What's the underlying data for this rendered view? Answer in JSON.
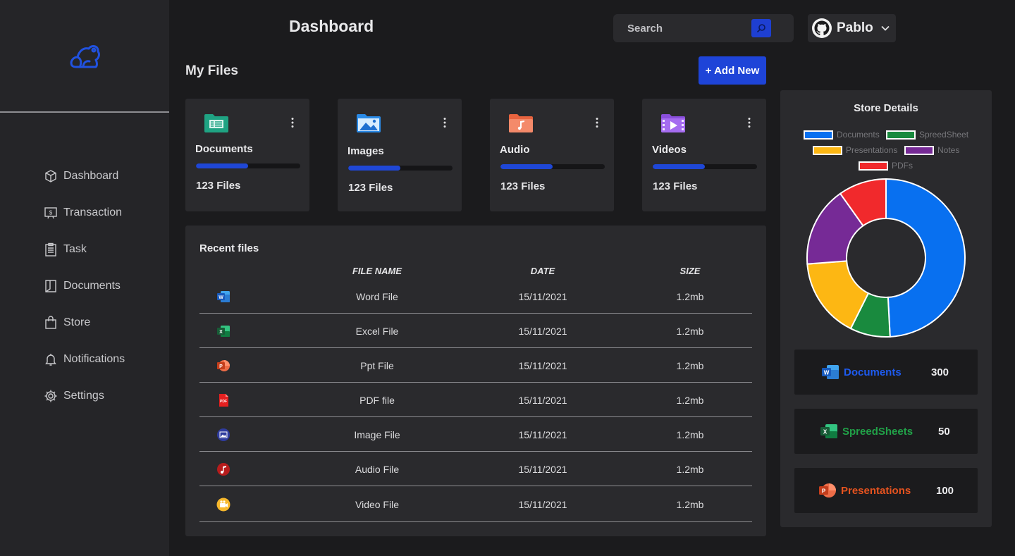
{
  "header": {
    "title": "Dashboard",
    "search_placeholder": "Search",
    "user_name": "Pablo"
  },
  "sidebar": {
    "items": [
      {
        "label": "Dashboard",
        "icon": "cube-icon"
      },
      {
        "label": "Transaction",
        "icon": "dollar-icon"
      },
      {
        "label": "Task",
        "icon": "clipboard-icon"
      },
      {
        "label": "Documents",
        "icon": "book-icon"
      },
      {
        "label": "Store",
        "icon": "bag-icon"
      },
      {
        "label": "Notifications",
        "icon": "bell-icon"
      },
      {
        "label": "Settings",
        "icon": "gear-icon"
      }
    ]
  },
  "my_files": {
    "title": "My Files",
    "add_label": "+ Add New",
    "cards": [
      {
        "name": "Documents",
        "count": "123 Files",
        "progress": 0.5,
        "color": "#1fa383"
      },
      {
        "name": "Images",
        "count": "123 Files",
        "progress": 0.5,
        "color": "#2a8be8"
      },
      {
        "name": "Audio",
        "count": "123 Files",
        "progress": 0.5,
        "color": "#f0795a"
      },
      {
        "name": "Videos",
        "count": "123 Files",
        "progress": 0.5,
        "color": "#9a5ae6"
      }
    ]
  },
  "recent": {
    "title": "Recent files",
    "columns": [
      "FILE NAME",
      "DATE",
      "SIZE"
    ],
    "rows": [
      {
        "icon": "word-icon",
        "name": "Word File",
        "date": "15/11/2021",
        "size": "1.2mb"
      },
      {
        "icon": "excel-icon",
        "name": "Excel File",
        "date": "15/11/2021",
        "size": "1.2mb"
      },
      {
        "icon": "powerpoint-icon",
        "name": "Ppt File",
        "date": "15/11/2021",
        "size": "1.2mb"
      },
      {
        "icon": "pdf-icon",
        "name": "PDF file",
        "date": "15/11/2021",
        "size": "1.2mb"
      },
      {
        "icon": "image-file-icon",
        "name": "Image File",
        "date": "15/11/2021",
        "size": "1.2mb"
      },
      {
        "icon": "audio-file-icon",
        "name": "Audio File",
        "date": "15/11/2021",
        "size": "1.2mb"
      },
      {
        "icon": "video-file-icon",
        "name": "Video File",
        "date": "15/11/2021",
        "size": "1.2mb"
      }
    ]
  },
  "store": {
    "title": "Store Details",
    "stats": [
      {
        "label": "Documents",
        "value": "300",
        "color": "#1e5bf0",
        "icon": "word-icon"
      },
      {
        "label": "SpreedSheets",
        "value": "50",
        "color": "#21a148",
        "icon": "excel-icon"
      },
      {
        "label": "Presentations",
        "value": "100",
        "color": "#e6531f",
        "icon": "powerpoint-icon"
      }
    ]
  },
  "chart_data": {
    "type": "pie",
    "categories": [
      "Documents",
      "SpreedSheet",
      "Presentations",
      "Notes",
      "PDFs"
    ],
    "values": [
      300,
      50,
      100,
      100,
      60
    ],
    "colors": [
      "#0870f0",
      "#198a3e",
      "#fdb713",
      "#762a96",
      "#f1292c"
    ],
    "legend": "top"
  }
}
